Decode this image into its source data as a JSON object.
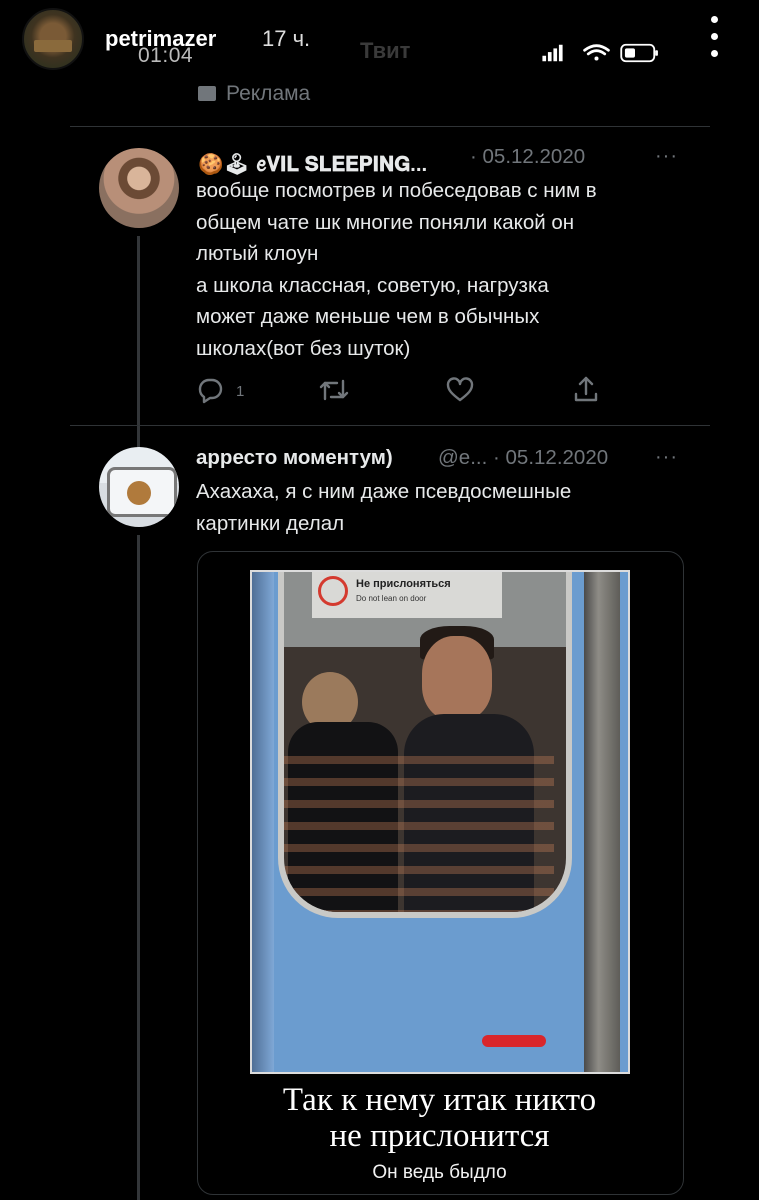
{
  "story": {
    "username": "petrimazer",
    "posted_ago": "17 ч."
  },
  "status_bar": {
    "time": "01:04"
  },
  "ad_label": "Реклама",
  "tweets": [
    {
      "display_name": "🍪🕹 ꫀ𝐕𝐈𝐋 𝐒𝐋𝐄𝐄𝐏𝐈𝐍𝐆...",
      "meta": "· 05.12.2020",
      "more": "···",
      "lines": [
        "вообще посмотрев и побеседовав с ним в",
        "общем чате шк многие поняли какой он",
        "лютый клоун",
        "а школа классная, советую, нагрузка",
        "может даже меньше чем в обычных",
        "школах(вот без шуток)"
      ],
      "reply_count": "1"
    },
    {
      "display_name": "арресто моментум)",
      "meta": "@e... · 05.12.2020",
      "more": "···",
      "lines": [
        "Ахахаха, я с ним даже псевдосмешные",
        "картинки делал"
      ]
    }
  ],
  "media": {
    "sign_title": "Не прислоняться",
    "sign_subtitle": "Do not lean on door",
    "caption_line1": "Так к нему итак никто",
    "caption_line2": "не прислонится",
    "caption_small": "Он ведь быдло"
  },
  "colors": {
    "background": "#000000",
    "text": "#e7e9ea",
    "muted": "#71767b",
    "divider": "#2f3336"
  }
}
